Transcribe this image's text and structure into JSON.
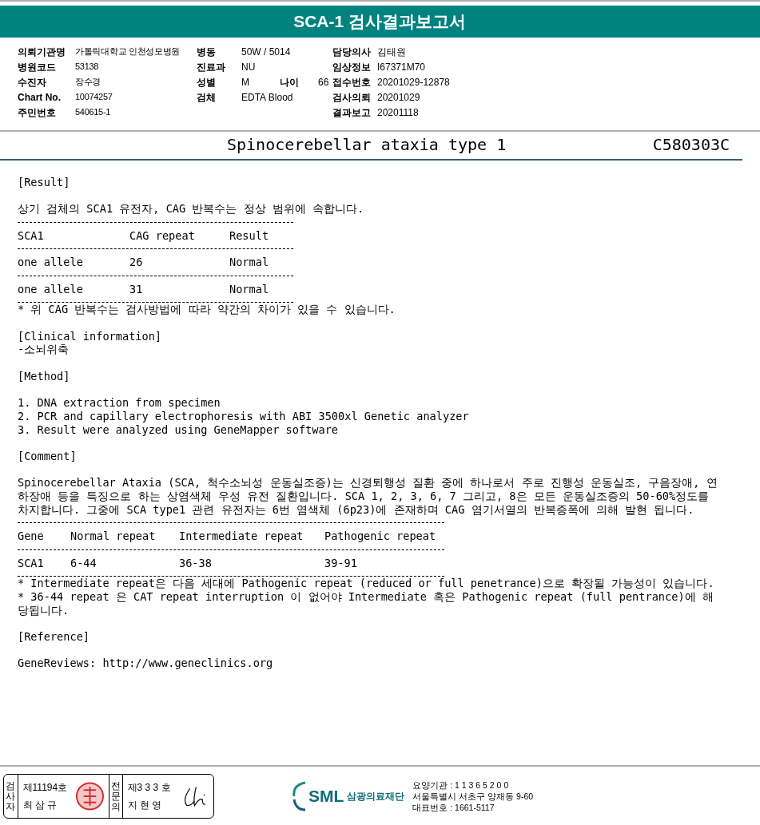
{
  "header": {
    "title": "SCA-1 검사결과보고서"
  },
  "info_columns": [
    [
      {
        "label": "의뢰기관명",
        "value": "가톨릭대학교 인천성모병원"
      },
      {
        "label": "병원코드",
        "value": "53138"
      },
      {
        "label": "수진자",
        "value": "장수경"
      },
      {
        "label": "Chart No.",
        "value": "10074257"
      },
      {
        "label": "주민번호",
        "value": "540615-1"
      }
    ],
    [
      {
        "label": "병동",
        "value": "50W / 5014"
      },
      {
        "label": "진료과",
        "value": "NU"
      },
      {
        "label": "성별",
        "value": "M",
        "extra_label": "나이",
        "extra_value": "66"
      },
      {
        "label": "검체",
        "value": "EDTA Blood"
      }
    ],
    [
      {
        "label": "담당의사",
        "value": "김태원"
      },
      {
        "label": "임상정보",
        "value": "I67371M70"
      },
      {
        "label": "접수번호",
        "value": "20201029-12878"
      },
      {
        "label": "검사의뢰",
        "value": "20201029"
      },
      {
        "label": "결과보고",
        "value": "20201118"
      }
    ]
  ],
  "report_title": {
    "name": "Spinocerebellar ataxia type 1",
    "code": "C580303C"
  },
  "blocks": [
    {
      "kind": "heading",
      "text": "[Result]"
    },
    {
      "kind": "gap"
    },
    {
      "kind": "text",
      "text": "상기 검체의 SCA1 유전자, CAG 반복수는 정상 범위에 속합니다."
    },
    {
      "kind": "table",
      "columns": [
        "SCA1",
        "CAG repeat",
        "Result"
      ],
      "rows": [
        [
          "one allele",
          "26",
          "Normal"
        ],
        [
          "one allele",
          "31",
          "Normal"
        ]
      ]
    },
    {
      "kind": "note",
      "text": "* 위 CAG 반복수는 검사방법에 따라 약간의 차이가 있을 수 있습니다."
    },
    {
      "kind": "gap"
    },
    {
      "kind": "heading",
      "text": "[Clinical information]"
    },
    {
      "kind": "text",
      "text": "-소뇌위축"
    },
    {
      "kind": "gap"
    },
    {
      "kind": "heading",
      "text": "[Method]"
    },
    {
      "kind": "gap"
    },
    {
      "kind": "text",
      "text": "1. DNA extraction from specimen"
    },
    {
      "kind": "text",
      "text": "2. PCR and capillary electrophoresis with ABI 3500xl Genetic analyzer"
    },
    {
      "kind": "text",
      "text": "3. Result were analyzed using GeneMapper software"
    },
    {
      "kind": "gap"
    },
    {
      "kind": "heading",
      "text": "[Comment]"
    },
    {
      "kind": "gap"
    },
    {
      "kind": "text",
      "text": "Spinocerebellar Ataxia (SCA, 척수소뇌성 운동실조증)는 신경퇴행성 질환 중에 하나로서 주로 진행성 운동실조, 구음장애, 연하장애 등을 특징으로 하는 상염색체 우성 유전 질환입니다. SCA 1, 2, 3, 6, 7 그리고, 8은 모든 운동실조증의 50-60%정도를 차지합니다. 그중에 SCA type1 관련 유전자는 6번 염색체 (6p23)에 존재하며 CAG 염기서열의 반복증폭에 의해 발현 됩니다."
    },
    {
      "kind": "table",
      "columns": [
        "Gene",
        "Normal repeat",
        "Intermediate repeat",
        "Pathogenic repeat"
      ],
      "rows": [
        [
          "SCA1",
          "6-44",
          "36-38",
          "39-91"
        ]
      ]
    },
    {
      "kind": "note",
      "text": "* Intermediate repeat은 다음 세대에 Pathogenic repeat (reduced or full penetrance)으로 확장될 가능성이 있습니다."
    },
    {
      "kind": "note",
      "text": "* 36-44 repeat 은 CAT repeat interruption 이 없어야 Intermediate 혹은 Pathogenic repeat (full pentrance)에 해당됩니다."
    },
    {
      "kind": "gap"
    },
    {
      "kind": "heading",
      "text": "[Reference]"
    },
    {
      "kind": "gap"
    },
    {
      "kind": "text",
      "text": "GeneReviews: http://www.geneclinics.org"
    }
  ],
  "footer": {
    "signers": [
      {
        "role": "검사자",
        "number": "제11194호",
        "name": "최 삼 규",
        "kind": "seal"
      },
      {
        "role": "전문의",
        "number": "제3 3 3 호",
        "name": "지 현 영",
        "kind": "signature"
      }
    ],
    "logo": {
      "abbr": "SML",
      "name": "삼광의료재단"
    },
    "contact": [
      "요양기관 : 1 1 3 6 5 2 0 0",
      "서울특별시 서초구 양재동 9-60",
      "대표번호 : 1661-5117"
    ]
  }
}
